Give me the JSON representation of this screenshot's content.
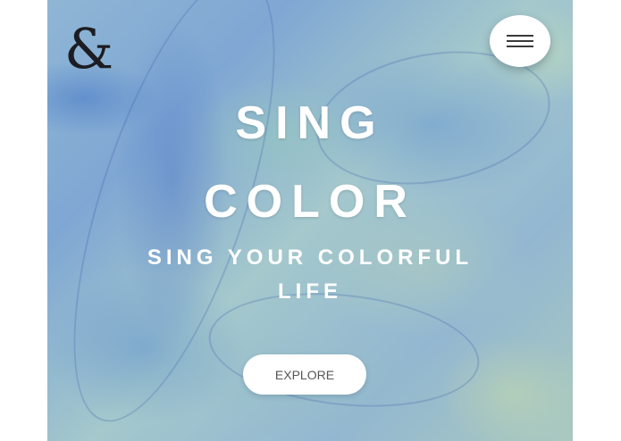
{
  "logo": {
    "glyph": "&",
    "icon": "ampersand-logo-icon"
  },
  "menu": {
    "icon": "hamburger-menu-icon"
  },
  "hero": {
    "title_line1": "SING",
    "title_line2": "COLOR",
    "subtitle_line1": "SING YOUR COLORFUL",
    "subtitle_line2": "LIFE",
    "cta_label": "EXPLORE"
  },
  "colors": {
    "background_primary": "#8fb6d4",
    "background_accent_blue": "#5a7fd0",
    "background_accent_green": "#b7d2b6",
    "text": "#ffffff",
    "button_bg": "#ffffff",
    "button_text": "#555555"
  }
}
